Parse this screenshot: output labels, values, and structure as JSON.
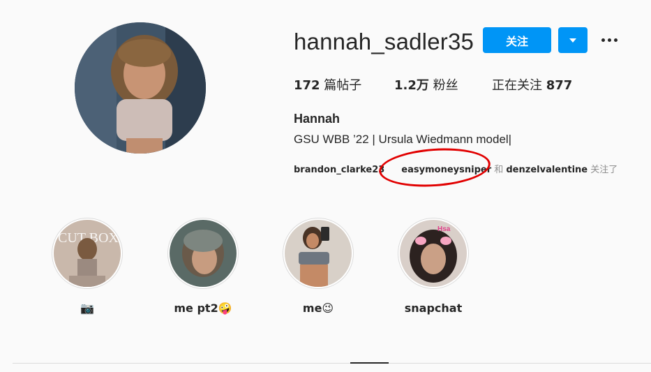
{
  "profile": {
    "username": "hannah_sadler35",
    "follow_label": "关注",
    "full_name": "Hannah",
    "bio": "GSU WBB ’22 | Ursula Wiedmann model|"
  },
  "stats": {
    "posts_count": "172",
    "posts_label": " 篇帖子",
    "followers_count": "1.2万",
    "followers_label": " 粉丝",
    "following_label": "正在关注 ",
    "following_count": "877"
  },
  "followed_by": {
    "user1": "brandon_clarke23",
    "user2": "easymoneysniper",
    "and": " 和 ",
    "user3": "denzelvalentine",
    "suffix": " 关注了"
  },
  "highlights": [
    {
      "label": "📷"
    },
    {
      "label": "me pt2🤪"
    },
    {
      "label": "me😉"
    },
    {
      "label": "snapchat"
    }
  ],
  "highlight_thumb_text": {
    "cover_text": "CUT BOX",
    "filter_text": "Hsa"
  },
  "colors": {
    "accent": "#0095f6",
    "annotation": "#e10000"
  }
}
